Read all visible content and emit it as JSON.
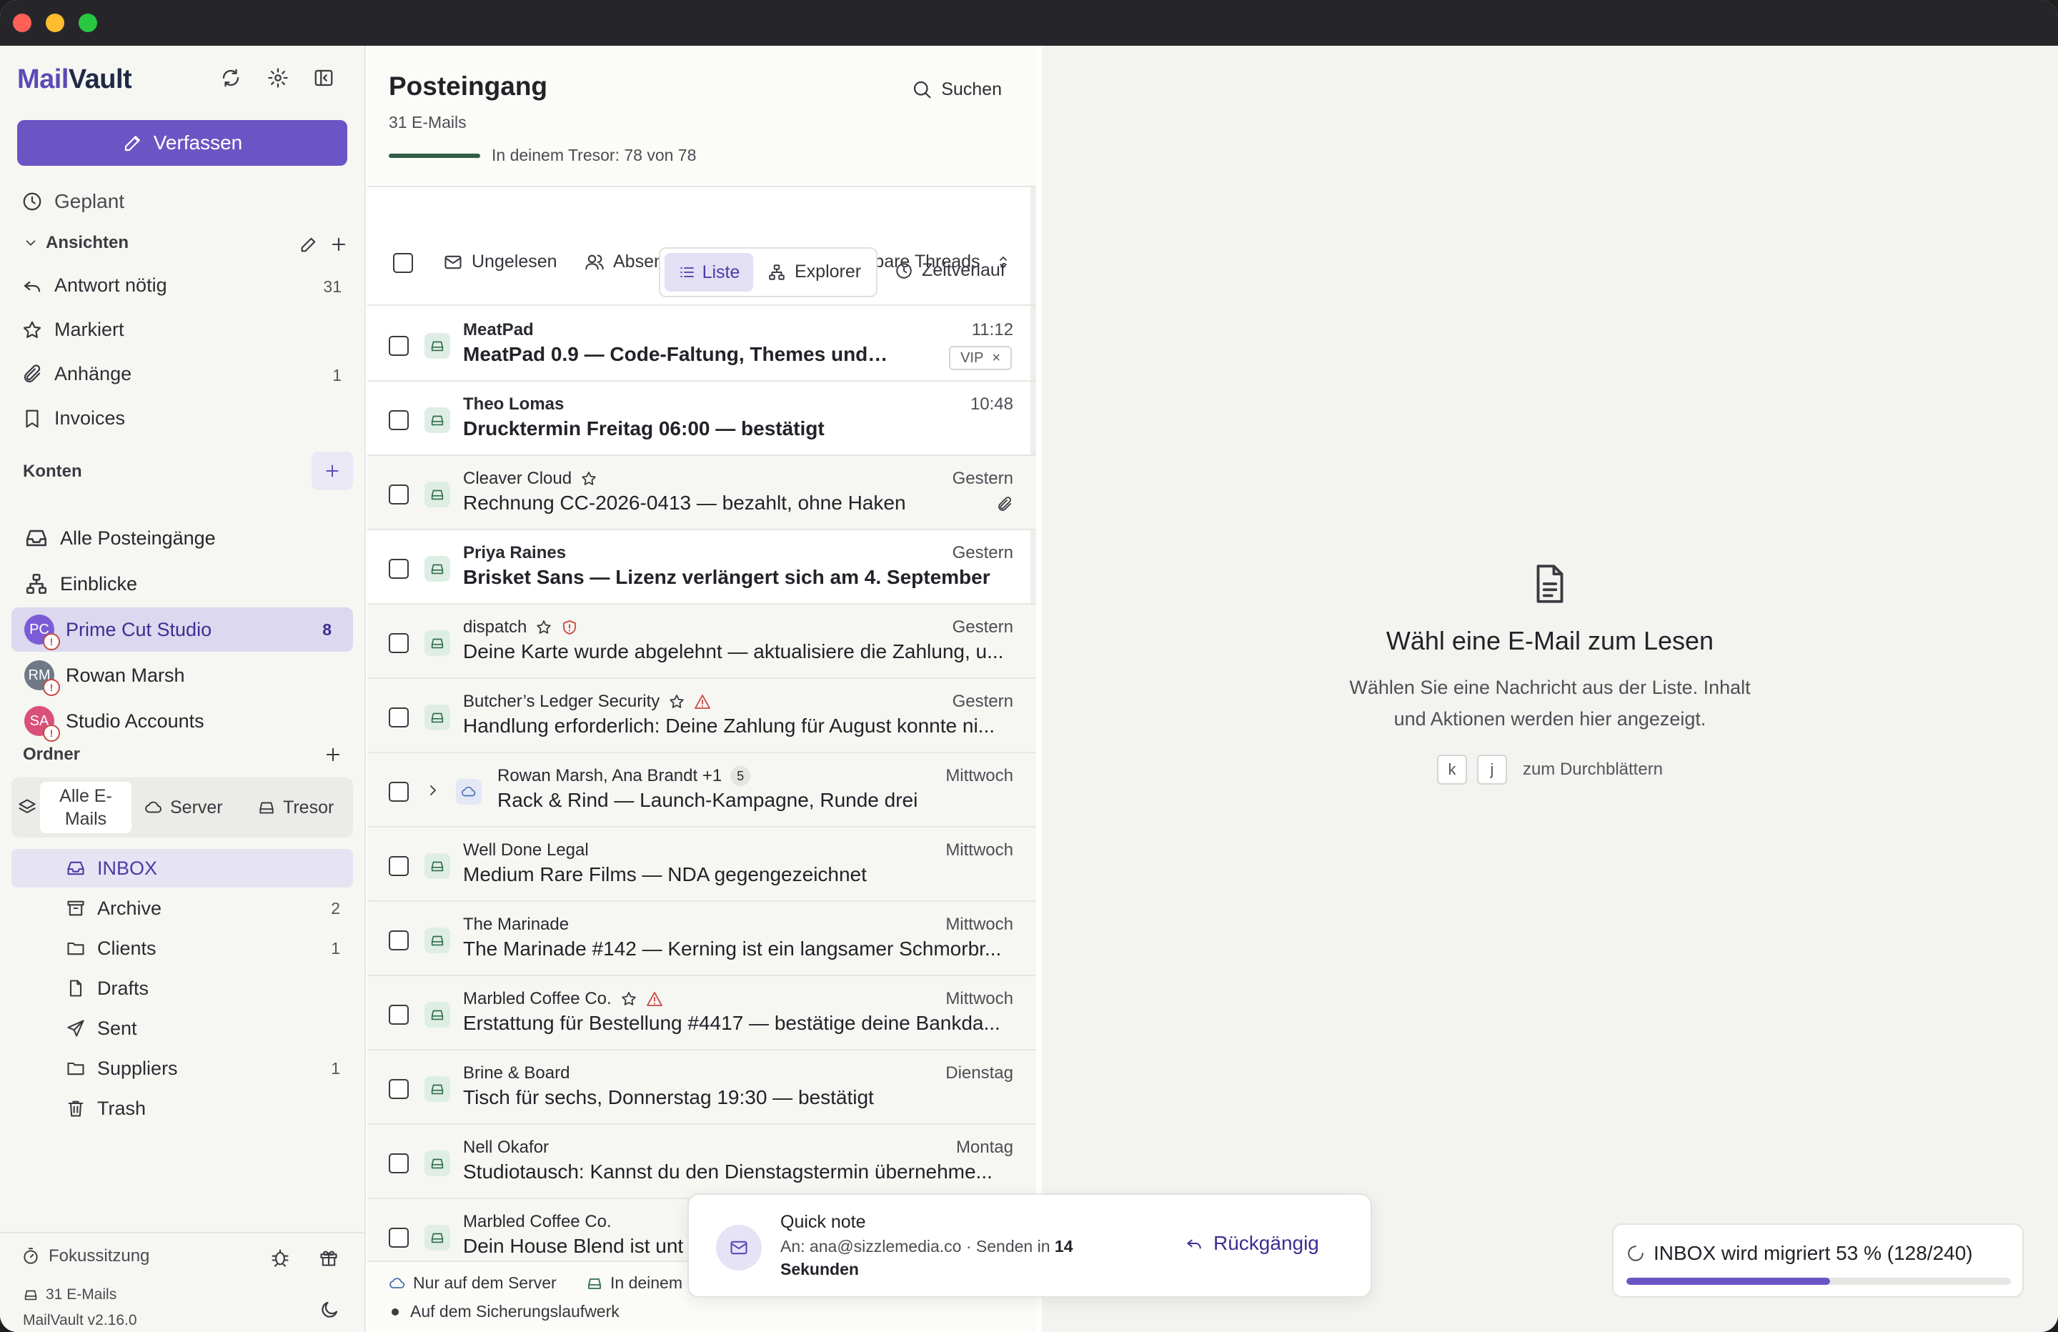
{
  "app": {
    "logo_mail": "Mail",
    "logo_vault": "Vault",
    "compose_label": "Verfassen"
  },
  "sidebar": {
    "scheduled_label": "Geplant",
    "views_section": "Ansichten",
    "views": [
      {
        "label": "Antwort nötig",
        "count": "31"
      },
      {
        "label": "Markiert",
        "count": ""
      },
      {
        "label": "Anhänge",
        "count": "1"
      },
      {
        "label": "Invoices",
        "count": ""
      }
    ],
    "accounts_section": "Konten",
    "accounts_top": [
      {
        "label": "Alle Posteingänge"
      },
      {
        "label": "Einblicke"
      }
    ],
    "accounts": [
      {
        "label": "Prime Cut Studio",
        "initials": "PC",
        "count": "8",
        "color": "#7b5cd6"
      },
      {
        "label": "Rowan Marsh",
        "initials": "RM",
        "count": "",
        "color": "#6f7a86"
      },
      {
        "label": "Studio Accounts",
        "initials": "SA",
        "count": "",
        "color": "#d9507a"
      }
    ],
    "folders_section": "Ordner",
    "folder_filter": {
      "all": "Alle E-Mails",
      "server": "Server",
      "vault": "Tresor"
    },
    "folders": [
      {
        "label": "INBOX",
        "count": ""
      },
      {
        "label": "Archive",
        "count": "2"
      },
      {
        "label": "Clients",
        "count": "1"
      },
      {
        "label": "Drafts",
        "count": ""
      },
      {
        "label": "Sent",
        "count": ""
      },
      {
        "label": "Suppliers",
        "count": "1"
      },
      {
        "label": "Trash",
        "count": ""
      }
    ],
    "footer": {
      "focus_label": "Fokussitzung",
      "mail_count": "31 E-Mails",
      "version": "MailVault v2.16.0"
    }
  },
  "list": {
    "title": "Posteingang",
    "subtitle": "31 E-Mails",
    "vault_status": "In deinem Tresor: 78 von 78",
    "search_label": "Suchen",
    "filters": {
      "unread": "Ungelesen",
      "sender": "Absender",
      "threads": "Aufklappbare Threads"
    },
    "views": {
      "list": "Liste",
      "explorer": "Explorer",
      "timeline": "Zeitverlauf"
    },
    "messages": [
      {
        "sender": "MeatPad",
        "time": "11:12",
        "subject": "MeatPad 0.9 — Code-Faltung, Themes und keine...",
        "unread": true,
        "tag": "VIP"
      },
      {
        "sender": "Theo Lomas",
        "time": "10:48",
        "subject": "Drucktermin Freitag 06:00 — bestätigt",
        "unread": true
      },
      {
        "sender": "Cleaver Cloud",
        "time": "Gestern",
        "subject": "Rechnung CC-2026-0413 — bezahlt, ohne Haken",
        "unread": false,
        "star": true,
        "attach": true
      },
      {
        "sender": "Priya Raines",
        "time": "Gestern",
        "subject": "Brisket Sans — Lizenz verlängert sich am 4. September",
        "unread": true
      },
      {
        "sender": "dispatch",
        "time": "Gestern",
        "subject": "Deine Karte wurde abgelehnt — aktualisiere die Zahlung, u...",
        "unread": false,
        "star": true,
        "shield": true
      },
      {
        "sender": "Butcher’s Ledger Security",
        "time": "Gestern",
        "subject": "Handlung erforderlich: Deine Zahlung für August konnte ni...",
        "unread": false,
        "star": true,
        "warn": true
      },
      {
        "sender": "Rowan Marsh, Ana Brandt +1",
        "time": "Mittwoch",
        "subject": "Rack & Rind — Launch-Kampagne, Runde drei",
        "unread": false,
        "thread": "5"
      },
      {
        "sender": "Well Done Legal",
        "time": "Mittwoch",
        "subject": "Medium Rare Films — NDA gegengezeichnet",
        "unread": false
      },
      {
        "sender": "The Marinade",
        "time": "Mittwoch",
        "subject": "The Marinade #142 — Kerning ist ein langsamer Schmorbr...",
        "unread": false
      },
      {
        "sender": "Marbled Coffee Co.",
        "time": "Mittwoch",
        "subject": "Erstattung für Bestellung #4417 — bestätige deine Bankda...",
        "unread": false,
        "star": true,
        "warn": true
      },
      {
        "sender": "Brine & Board",
        "time": "Dienstag",
        "subject": "Tisch für sechs, Donnerstag 19:30 — bestätigt",
        "unread": false
      },
      {
        "sender": "Nell Okafor",
        "time": "Montag",
        "subject": "Studiotausch: Kannst du den Dienstagstermin übernehme...",
        "unread": false
      },
      {
        "sender": "Marbled Coffee Co.",
        "time": "",
        "subject": "Dein House Blend ist unt",
        "unread": false
      }
    ],
    "legend": {
      "server_only": "Nur auf dem Server",
      "in_vault": "In deinem",
      "backup": "Auf dem Sicherungslaufwerk"
    }
  },
  "pane": {
    "title": "Wähl eine E-Mail zum Lesen",
    "text_line1": "Wählen Sie eine Nachricht aus der Liste. Inhalt",
    "text_line2": "und Aktionen werden hier angezeigt.",
    "key_k": "k",
    "key_j": "j",
    "key_hint": "zum Durchblättern"
  },
  "toast": {
    "title": "Quick note",
    "to_prefix": "An: ana@sizzlemedia.co · Senden in",
    "seconds": "14",
    "seconds_label": "Sekunden",
    "undo": "Rückgängig"
  },
  "migration": {
    "label": "INBOX wird migriert 53 % (128/240)",
    "progress": 0.53
  },
  "colors": {
    "accent": "#6b55c4",
    "vault_bar": "#2f5f46"
  }
}
